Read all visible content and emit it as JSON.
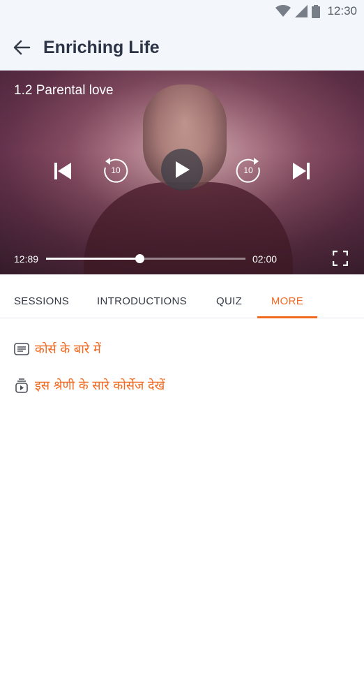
{
  "status_bar": {
    "time": "12:30",
    "icons": [
      "wifi-icon",
      "signal-icon",
      "battery-icon"
    ]
  },
  "app_bar": {
    "back_icon": "arrow-left-icon",
    "title": "Enriching Life"
  },
  "player": {
    "video_title": "1.2 Parental love",
    "rewind_seconds": "10",
    "forward_seconds": "10",
    "current_time": "12:89",
    "total_time": "02:00",
    "progress_fraction": 0.47,
    "controls": [
      "skip-previous-icon",
      "rewind-10-icon",
      "play-icon",
      "forward-10-icon",
      "skip-next-icon",
      "fullscreen-icon"
    ]
  },
  "tabs": [
    {
      "label": "SESSIONS",
      "active": false
    },
    {
      "label": "INTRODUCTIONS",
      "active": false
    },
    {
      "label": "QUIZ",
      "active": false
    },
    {
      "label": "MORE",
      "active": true
    }
  ],
  "more": {
    "items": [
      {
        "icon": "article-icon",
        "label": "कोर्स के बारे में"
      },
      {
        "icon": "playlist-play-icon",
        "label": "इस श्रेणी के सारे कोर्सेज देखें"
      }
    ]
  },
  "colors": {
    "accent": "#f26a21",
    "app_bar_bg": "#f3f7fb",
    "title_text": "#2d3446"
  }
}
